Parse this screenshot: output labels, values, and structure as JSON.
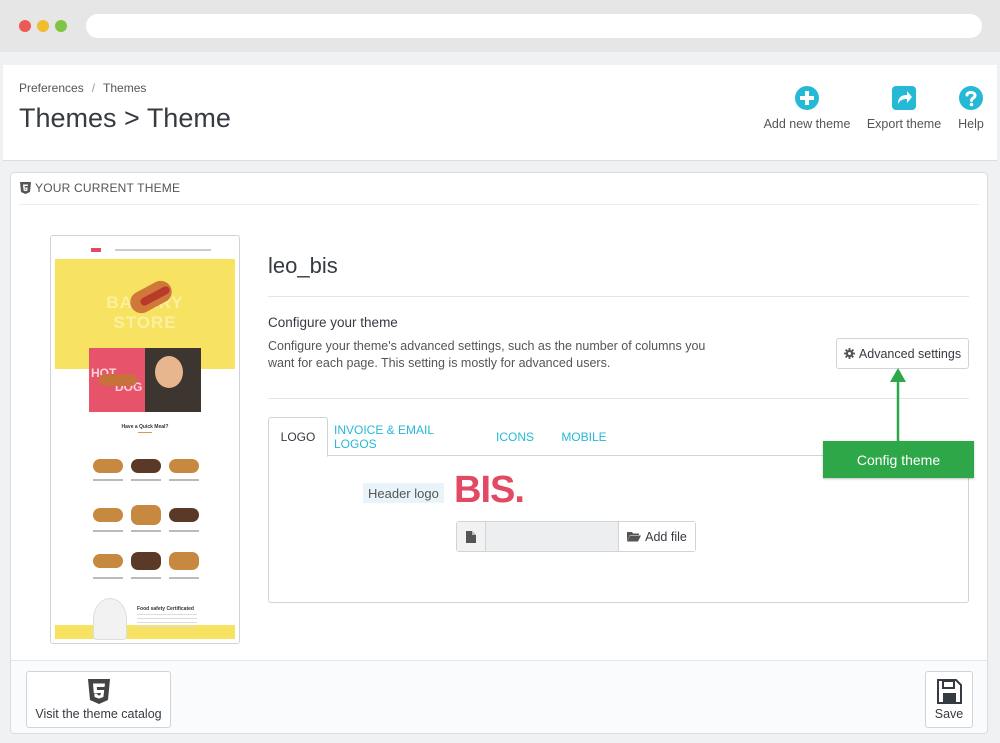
{
  "breadcrumb": {
    "parent": "Preferences",
    "current": "Themes"
  },
  "page_title": "Themes > Theme",
  "toolbar": {
    "add_theme": "Add new theme",
    "export_theme": "Export theme",
    "help": "Help"
  },
  "panel": {
    "heading": "YOUR CURRENT THEME",
    "theme_name": "leo_bis",
    "configure_title": "Configure your theme",
    "configure_desc": "Configure your theme's advanced settings, such as the number of columns you want for each page. This setting is mostly for advanced users.",
    "advanced_settings": "Advanced settings",
    "annotation": "Config theme",
    "tabs": [
      {
        "label": "LOGO",
        "active": true
      },
      {
        "label": "INVOICE & EMAIL LOGOS",
        "active": false
      },
      {
        "label": "ICONS",
        "active": false
      },
      {
        "label": "MOBILE",
        "active": false
      }
    ],
    "logo": {
      "label": "Header logo",
      "logo_text": "BIS.",
      "add_file": "Add file",
      "file_value": ""
    },
    "footer": {
      "catalog_button": "Visit the theme catalog",
      "save_button": "Save"
    }
  },
  "preview": {
    "hero_line1": "BAKERY",
    "hero_line2": "STORE",
    "banner_text": "HOT",
    "banner_text2": "DOG",
    "section_heading": "Have a Quick Meal?",
    "certificate": "Food safety Certificated"
  },
  "colors": {
    "accent": "#25b9d7",
    "annotation_green": "#2ea749",
    "logo_red": "#e14a62",
    "preview_yellow": "#f7e261"
  },
  "icons": {
    "add_theme": "plus-circle-icon",
    "export_theme": "share-icon",
    "help": "question-circle-icon",
    "heading": "html5-icon",
    "advanced": "gear-icon",
    "file": "file-icon",
    "add_file": "folder-open-icon",
    "catalog": "html5-icon",
    "save": "floppy-disk-icon"
  }
}
